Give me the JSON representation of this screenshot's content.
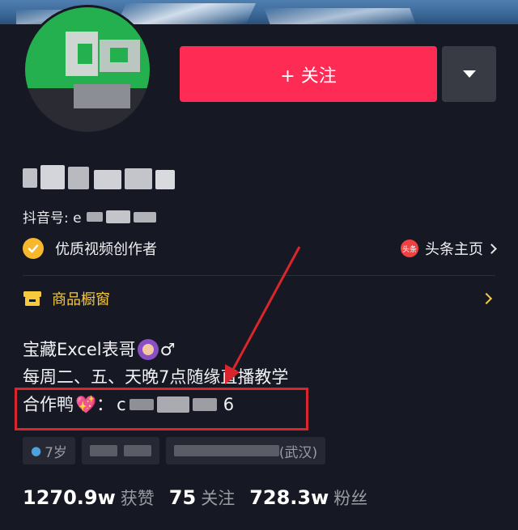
{
  "profile": {
    "follow_label": "+ 关注",
    "douyin_id_label": "抖音号: e",
    "verify_label": "优质视频创作者",
    "toutiao_badge": "头条",
    "toutiao_label": "头条主页",
    "shop_label": "商品橱窗",
    "bio": {
      "line1_start": "宝藏Excel表哥",
      "line1_end": "♂",
      "line2": "每周二、五、天晚7点随缘直播教学",
      "line3_label": "合作鸭",
      "line3_heart": "💖",
      "line3_sep": "：",
      "line3_end": "c",
      "line3_tail": "6"
    },
    "tags": {
      "age": "7岁",
      "location_end": "(武汉)"
    },
    "stats": [
      {
        "num": "1270.9w",
        "label": "获赞"
      },
      {
        "num": "75",
        "label": "关注"
      },
      {
        "num": "728.3w",
        "label": "粉丝"
      }
    ]
  },
  "colors": {
    "background": "#161823",
    "follow": "#fe2c55",
    "shop": "#f7c93e",
    "verify": "#f7b82d",
    "annotation": "#d9262c"
  },
  "icons": {
    "verify": "check-circle-icon",
    "toutiao": "toutiao-icon",
    "shop": "storefront-icon",
    "more": "dropdown-triangle-icon"
  }
}
